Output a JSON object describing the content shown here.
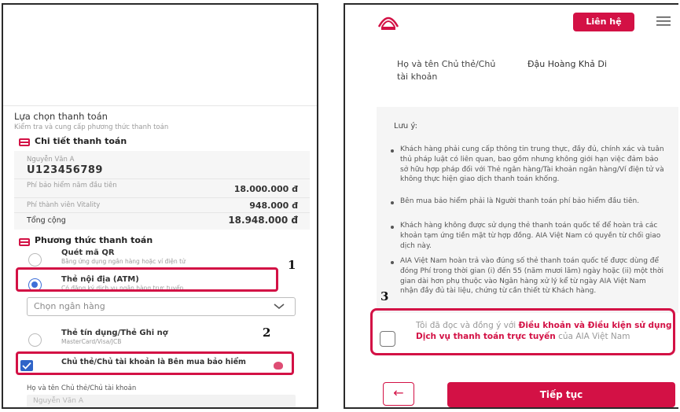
{
  "left": {
    "section_title": "Lựa chọn thanh toán",
    "section_subtitle": "Kiểm tra và cung cấp phương thức thanh toán",
    "details_title": "Chi tiết thanh toán",
    "customer_name": "Nguyễn Văn A",
    "customer_id": "U123456789",
    "fee_rows": [
      {
        "label": "Phí bảo hiểm năm đầu tiên",
        "value": "18.000.000 đ"
      },
      {
        "label": "Phí thành viên Vitality",
        "value": "948.000 đ"
      }
    ],
    "total_label": "Tổng cộng",
    "total_value": "18.948.000 đ",
    "method_title": "Phương thức thanh toán",
    "options": [
      {
        "title": "Quét mã QR",
        "desc": "Bằng ứng dụng ngân hàng hoặc ví điện tử"
      },
      {
        "title": "Thẻ nội địa (ATM)",
        "desc": "Có đăng ký dịch vụ ngân hàng trực tuyến"
      },
      {
        "title": "Thẻ tín dụng/Thẻ Ghi nợ",
        "desc": "MasterCard/Visa/JCB"
      }
    ],
    "bank_select_placeholder": "Chọn ngân hàng",
    "owner_checkbox_label": "Chủ thẻ/Chủ tài khoản là Bên mua bảo hiểm",
    "holder_field_label": "Họ và tên Chủ thẻ/Chủ tài khoản",
    "holder_field_value": "Nguyễn Văn A"
  },
  "annotations": [
    "1",
    "2",
    "3"
  ],
  "right": {
    "contact_button": "Liên hệ",
    "holder_label": "Họ và tên Chủ thẻ/Chủ tài khoản",
    "holder_value": "Đậu Hoàng Khả Di",
    "note_title": "Lưu ý:",
    "notes": [
      "Khách hàng phải cung cấp thông tin trung thực, đầy đủ, chính xác và tuân thủ pháp luật có liên quan, bao gồm nhưng không giới hạn việc đảm bảo sở hữu hợp pháp đối với Thẻ ngân hàng/Tài khoản ngân hàng/Ví điện tử và không thực hiện giao dịch thanh toán khống.",
      "Bên mua bảo hiểm phải là Người thanh toán phí bảo hiểm đầu tiên.",
      "Khách hàng không được sử dụng thẻ thanh toán quốc tế để hoàn trả các khoản tạm ứng tiền mặt từ hợp đồng. AIA Việt Nam có quyền từ chối giao dịch này.",
      "AIA Việt Nam hoàn trả vào đúng số thẻ thanh toán quốc tế được dùng để đóng Phí trong thời gian (i) đến 55 (năm mươi lăm) ngày hoặc (ii) một thời gian dài hơn phụ thuộc vào Ngân hàng xử lý kể từ ngày AIA Việt Nam nhận đầy đủ tài liệu, chứng từ cần thiết từ Khách hàng."
    ],
    "agree_prefix": "Tôi đã đọc và đồng ý với ",
    "agree_link": "Điều khoản và Điều kiện sử dụng Dịch vụ thanh toán trực tuyến",
    "agree_suffix": " của AIA Việt Nam",
    "back_arrow": "←",
    "continue_button": "Tiếp tục"
  },
  "colors": {
    "brand": "#d31145",
    "radio_selected": "#3f6fd8",
    "checkbox": "#2f64c8"
  },
  "icons": [
    "card-icon",
    "aia-logo-icon",
    "menu-icon",
    "chevron-down-icon",
    "check-icon",
    "arrow-left-icon"
  ]
}
